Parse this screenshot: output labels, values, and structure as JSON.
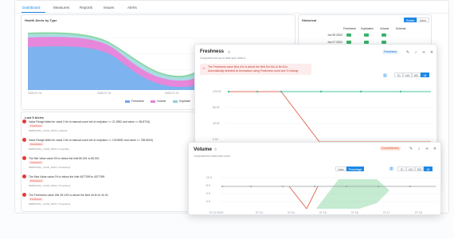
{
  "nav": {
    "tabs": [
      "Dashboard",
      "Measures",
      "Reports",
      "Issues",
      "Alerts"
    ]
  },
  "health": {
    "title": "Health Alerts by Type",
    "x_ticks": [
      "2025-07-01",
      "2025-07-02",
      "2025-07-03",
      "2025-07-04"
    ],
    "legend": [
      "Freshness",
      "Volume",
      "Duplicate",
      "Schema"
    ],
    "colors": {
      "Freshness": "#6aa6ea",
      "Volume": "#e37fd7",
      "Duplicate": "#8fd0d6",
      "Schema": "#56c27a"
    }
  },
  "historical": {
    "title": "Historical",
    "toggle": [
      "Grades",
      "Alerts"
    ],
    "columns": [
      "Freshness",
      "Duplicates",
      "Volume",
      "Schema"
    ],
    "rows": [
      {
        "date": "Jun 26 2024"
      },
      {
        "date": "Jun 27 2024"
      }
    ]
  },
  "last_alerts": {
    "title": "Last 5 Alerts",
    "items": [
      {
        "msg": "Value Range failed for value 2.6e to manual count set of not(value >= 21.3952 and value <= 56.8734)",
        "badge": "Freshness",
        "sub": "PERSONAL_LOAN_DATA | Latitude"
      },
      {
        "msg": "Value Range failed for value 2.6e to manual count set of not(value >= 100.8952 and value <= 785.5543)",
        "badge": "Distribution",
        "sub": "PERSONAL_LOAN_DATA | Longitude"
      },
      {
        "msg": "The Min Value value 6% is below the limit 80,001 to 80,001",
        "badge": "Freshness",
        "sub": "PERSONAL_LOAN_DATA | Timestamp"
      },
      {
        "msg": "The Max Value value 0% is below the limit 4577099 to 4577099",
        "badge": "Distribution",
        "sub": "PERSONAL_LOAN_DATA | Timestamp"
      },
      {
        "msg": "The Freshness value 186 35.10% is above the limit 4h 4h to 4h 4h",
        "badge": "Freshness",
        "sub": "PERSONAL_LOAN_DATA | Timestamp"
      }
    ]
  },
  "freshness": {
    "title": "Freshness",
    "subtitle": "Computes how up to date your data is",
    "tag": "Freshness",
    "alert_line1": "The Freshness value 6hrs 41h is above the limit 5m 51s to 5m 51s",
    "alert_line2": "Automatically detected AI Anomalous using Freshness count and % change",
    "ranges": [
      "7D",
      "14D",
      "30D",
      "All"
    ],
    "y_ticks": [
      "120.00",
      "80.00",
      "40.00",
      "0.00"
    ],
    "x_ticks": [
      "07-12-2024",
      "07-13",
      "07-14",
      "07-15",
      "07-16",
      "07-17",
      "07-18"
    ]
  },
  "volume": {
    "title": "Volume",
    "subtitle": "Computes the total rows count",
    "tag": "Completeness",
    "toggle": [
      "Value",
      "Percentage"
    ],
    "ranges": [
      "7D",
      "14D",
      "30D",
      "All"
    ],
    "y_ticks": [
      "10 K",
      "8 K",
      "6 K",
      "4 K"
    ],
    "x_ticks": [
      "07-12-2024",
      "07-13",
      "07-14",
      "07-15",
      "07-16",
      "07-17",
      "07-18"
    ]
  }
}
